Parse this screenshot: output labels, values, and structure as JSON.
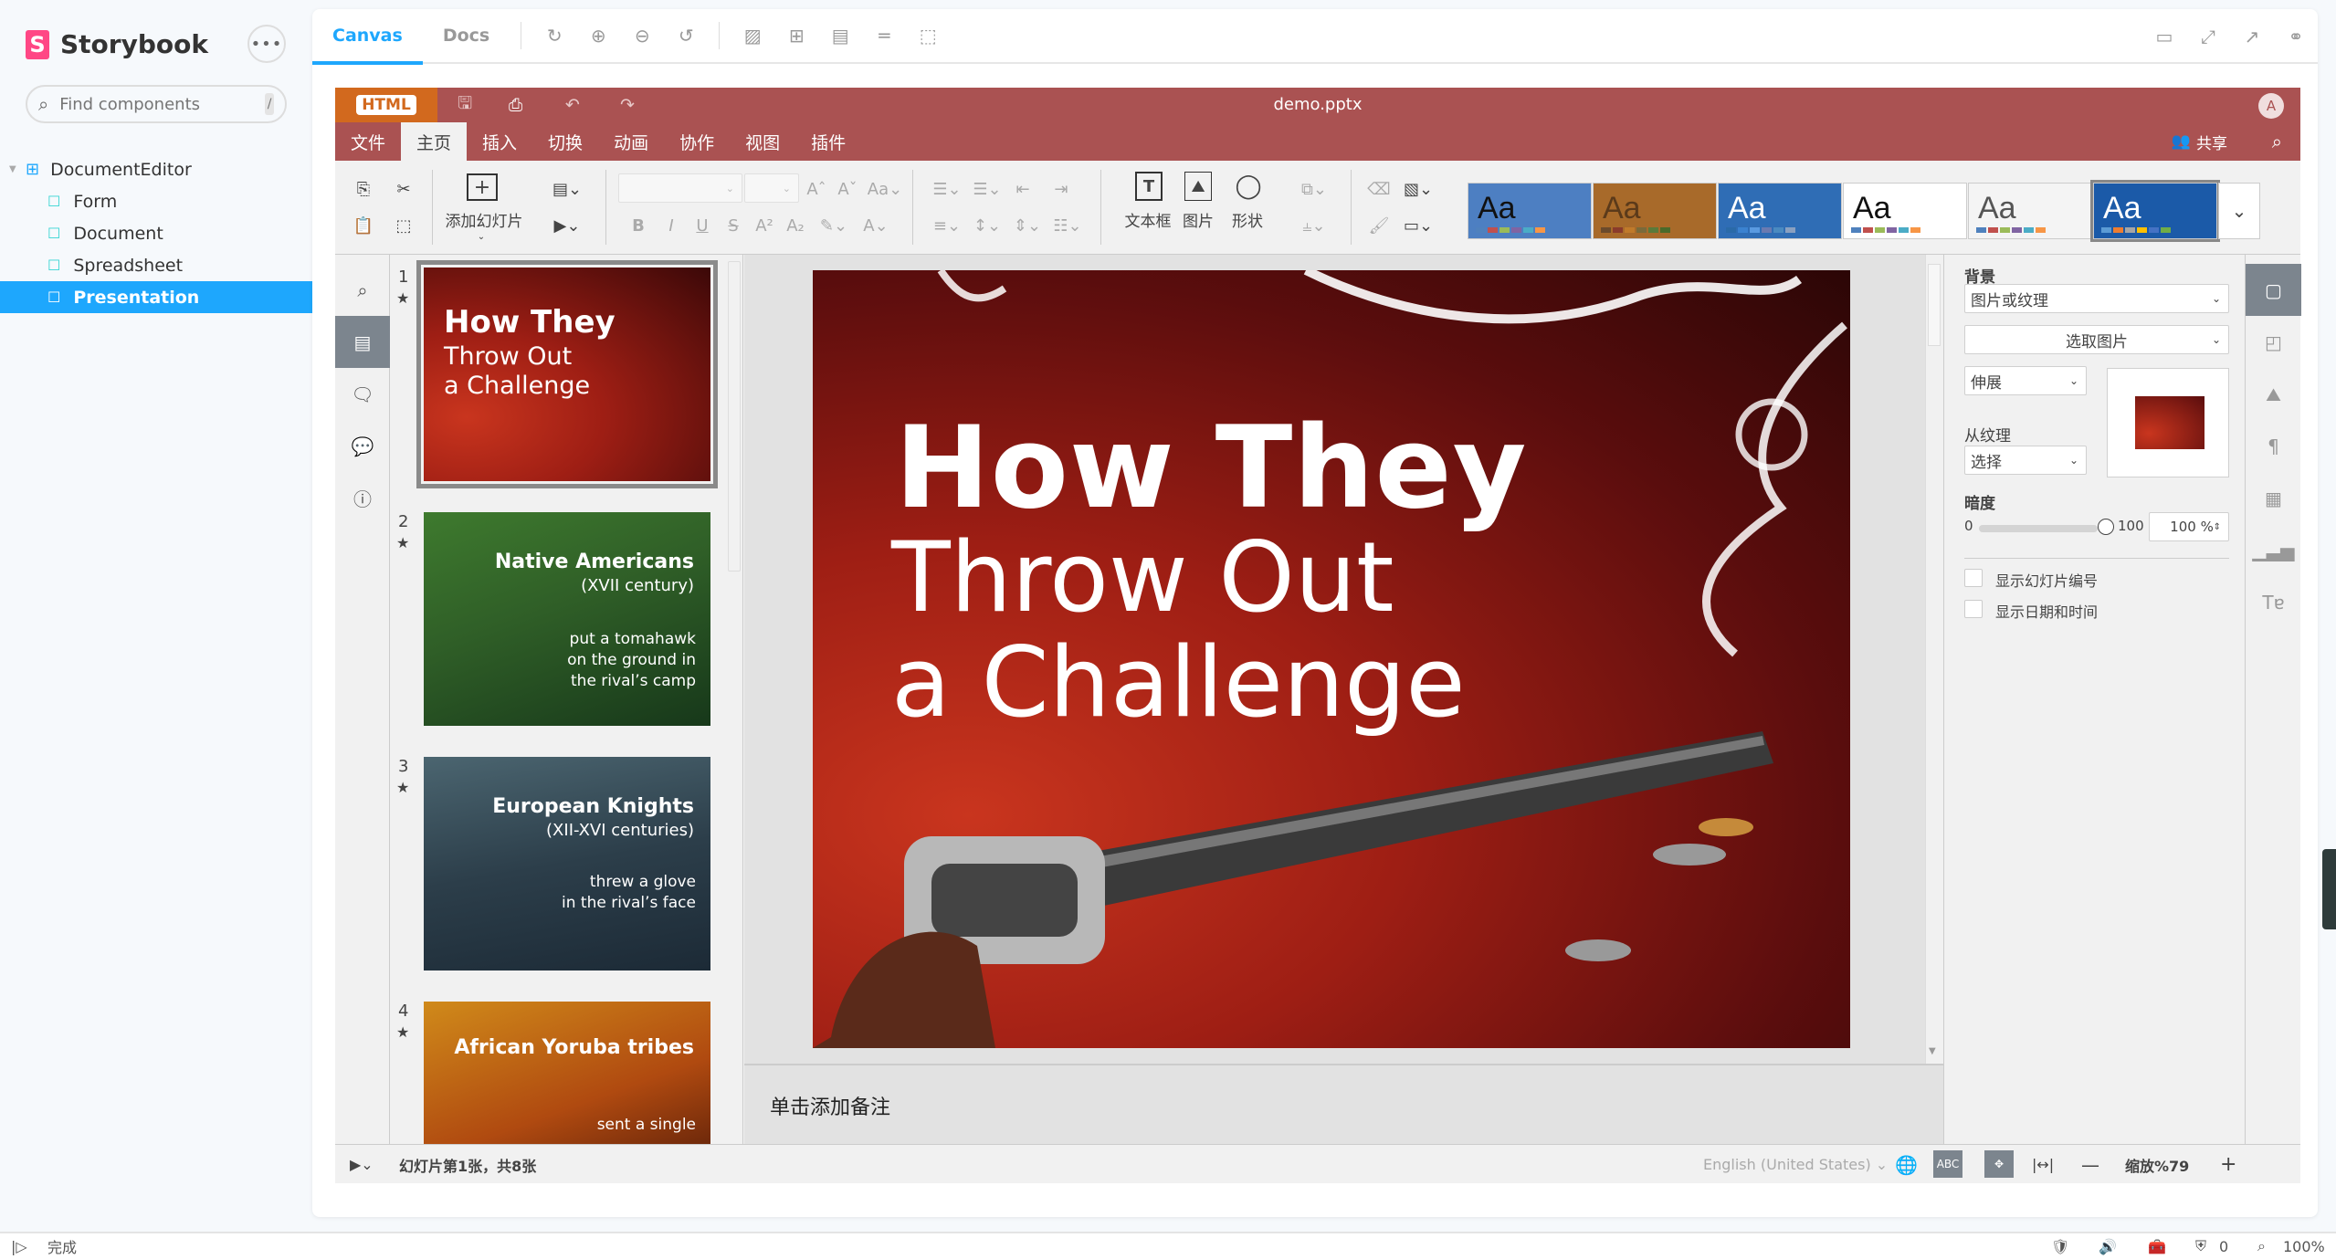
{
  "sidebar": {
    "brand": "Storybook",
    "menu_label": "•••",
    "search_placeholder": "Find components",
    "search_shortcut": "/",
    "tree": {
      "group": "DocumentEditor",
      "items": [
        {
          "label": "Form",
          "selected": false
        },
        {
          "label": "Document",
          "selected": false
        },
        {
          "label": "Spreadsheet",
          "selected": false
        },
        {
          "label": "Presentation",
          "selected": true
        }
      ]
    }
  },
  "toolbar": {
    "tabs": [
      {
        "label": "Canvas",
        "active": true
      },
      {
        "label": "Docs",
        "active": false
      }
    ],
    "icons_left": [
      "reload-icon",
      "zoom-in-icon",
      "zoom-out-icon",
      "zoom-reset-icon",
      "background-icon",
      "grid-icon",
      "viewport-icon",
      "measure-icon",
      "outline-icon"
    ],
    "icons_right": [
      "panel-icon",
      "fullscreen-icon",
      "open-new-tab-icon",
      "copy-link-icon"
    ]
  },
  "editor": {
    "logo": "HTML",
    "doc_title": "demo.pptx",
    "avatar_initial": "A",
    "share_label": "共享",
    "menu": [
      {
        "label": "文件",
        "active": false
      },
      {
        "label": "主页",
        "active": true
      },
      {
        "label": "插入",
        "active": false
      },
      {
        "label": "切换",
        "active": false
      },
      {
        "label": "动画",
        "active": false
      },
      {
        "label": "协作",
        "active": false
      },
      {
        "label": "视图",
        "active": false
      },
      {
        "label": "插件",
        "active": false
      }
    ],
    "ribbon": {
      "add_slide": "添加幻灯片",
      "textbox": "文本框",
      "image": "图片",
      "shape": "形状",
      "font_name": "",
      "font_size": ""
    },
    "themes": [
      {
        "name": "theme-blank-blue",
        "bg": "#4d7fc2",
        "fg": "#111",
        "swatches": [
          "#4f81bd",
          "#c0504d",
          "#9bbb59",
          "#8064a2",
          "#4bacc6",
          "#f79646"
        ]
      },
      {
        "name": "theme-vintage",
        "bg": "#a86a2a",
        "fg": "#5b3a1a",
        "swatches": [
          "#6b4a2b",
          "#8a3b2b",
          "#c07a2a",
          "#7a6a3a",
          "#5a7a3a",
          "#4a6a2a"
        ]
      },
      {
        "name": "theme-blue-dots",
        "bg": "#2f6db5",
        "fg": "#fff",
        "swatches": [
          "#2a6aa8",
          "#3b82d0",
          "#5a9ae0",
          "#6a7ab0",
          "#4a8ac0",
          "#8aa0c0"
        ]
      },
      {
        "name": "theme-white-blue",
        "bg": "#ffffff",
        "fg": "#111",
        "swatches": [
          "#4f81bd",
          "#c0504d",
          "#9bbb59",
          "#8064a2",
          "#4bacc6",
          "#f79646"
        ]
      },
      {
        "name": "theme-gray",
        "bg": "#f4f4f4",
        "fg": "#555",
        "swatches": [
          "#4f81bd",
          "#c0504d",
          "#9bbb59",
          "#8064a2",
          "#4bacc6",
          "#f79646"
        ]
      },
      {
        "name": "theme-blue-sky",
        "bg": "#1b5aa8",
        "fg": "#fff",
        "swatches": [
          "#5b9bd5",
          "#ed7d31",
          "#a5a5a5",
          "#ffc000",
          "#4472c4",
          "#70ad47"
        ]
      }
    ],
    "slides": [
      {
        "num": "1",
        "title": "How They",
        "subtitle": "Throw Out",
        "subtitle2": "a Challenge",
        "body": "",
        "bg": "radial-gradient(ellipse at 15% 70%,#c9351e 0%,#9e1e14 40%,#3b0808 100%)",
        "selected": true
      },
      {
        "num": "2",
        "title": "Native Americans",
        "subtitle": "(XVII century)",
        "subtitle2": "",
        "body": "put a tomahawk\non the ground in\nthe rival’s camp",
        "bg": "linear-gradient(160deg,#3e7a2e 0%,#2f5e27 45%,#17381a 100%)",
        "selected": false
      },
      {
        "num": "3",
        "title": "European Knights",
        "subtitle": "(XII-XVI centuries)",
        "subtitle2": "",
        "body": "threw a glove\nin the rival’s face",
        "bg": "linear-gradient(170deg,#4b6570 0%,#2c3e4a 50%,#1c2a36 100%)",
        "selected": false
      },
      {
        "num": "4",
        "title": "African Yoruba tribes",
        "subtitle": "",
        "subtitle2": "",
        "body": "sent a single",
        "bg": "linear-gradient(160deg,#d08a1a 0%,#b04a10 50%,#3a0e06 100%)",
        "selected": false
      }
    ],
    "current_slide": {
      "title": "How They",
      "line2": "Throw Out",
      "line3": "a Challenge"
    },
    "notes_placeholder": "单击添加备注",
    "right_panel": {
      "background_label": "背景",
      "fill_type": "图片或纹理",
      "pick_image": "选取图片",
      "stretch": "伸展",
      "from_texture_label": "从纹理",
      "texture_select": "选择",
      "opacity_label": "暗度",
      "opacity_min": "0",
      "opacity_max": "100",
      "opacity_value": "100 %",
      "opacity_percent": 100,
      "show_slide_number": "显示幻灯片编号",
      "show_slide_number_checked": false,
      "show_date_time": "显示日期和时间",
      "show_date_time_checked": false
    },
    "status": {
      "slide_info": "幻灯片第1张，共8张",
      "language": "English (United States)",
      "zoom_label": "缩放%79"
    }
  },
  "browser_status": {
    "left_text": "完成",
    "adblock_count": "0",
    "zoom": "100%"
  }
}
